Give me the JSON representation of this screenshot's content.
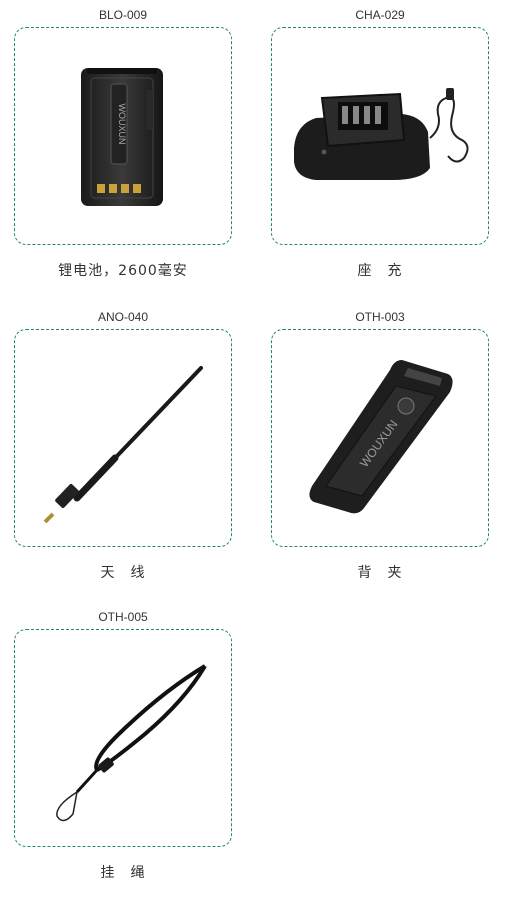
{
  "products": [
    {
      "code": "BLO-009",
      "caption": "锂电池，2600毫安",
      "icon": "battery-pack-image"
    },
    {
      "code": "CHA-029",
      "caption": "座　充",
      "icon": "desktop-charger-image"
    },
    {
      "code": "ANO-040",
      "caption": "天　线",
      "icon": "antenna-image"
    },
    {
      "code": "OTH-003",
      "caption": "背　夹",
      "icon": "belt-clip-image"
    },
    {
      "code": "OTH-005",
      "caption": "挂　绳",
      "icon": "lanyard-image"
    }
  ],
  "brand_text": "WOUXUN",
  "frame_border_color": "#1f8a6b"
}
